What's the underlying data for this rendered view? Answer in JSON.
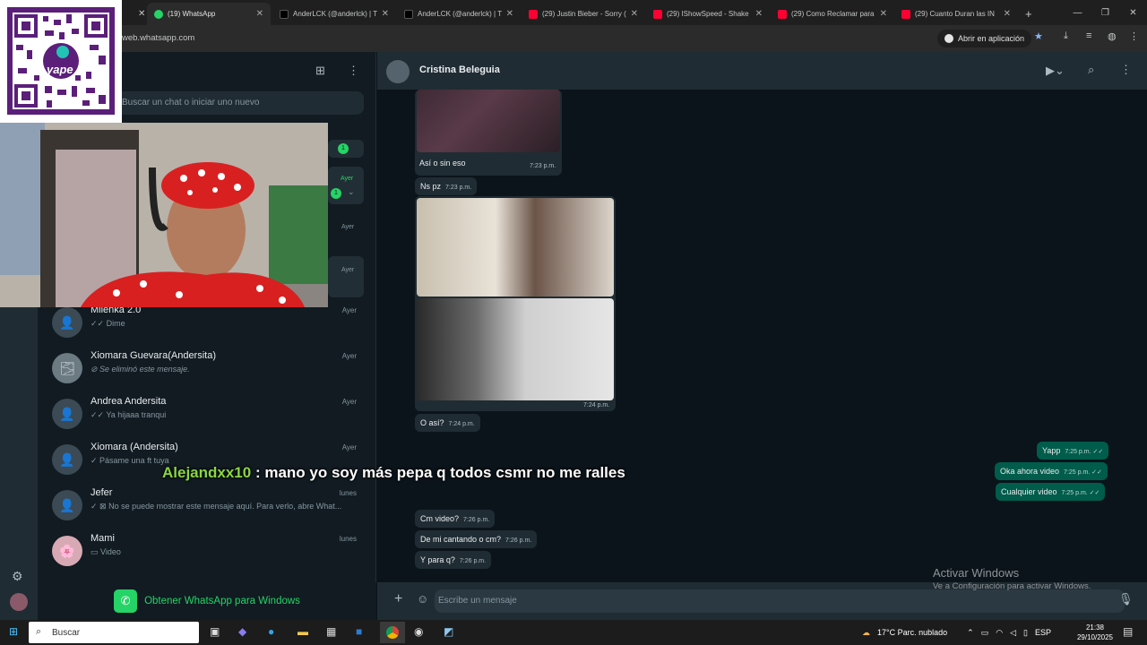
{
  "browser": {
    "tabs": [
      {
        "title": "(19) WhatsApp",
        "color": "#25d366",
        "active": true
      },
      {
        "title": "AnderLCK (@anderlck) | T",
        "color": "#000000"
      },
      {
        "title": "AnderLCK (@anderlck) | T",
        "color": "#000000"
      },
      {
        "title": "(29) Justin Bieber - Sorry (",
        "color": "#ff0033"
      },
      {
        "title": "(29) IShowSpeed - Shake",
        "color": "#ff0033"
      },
      {
        "title": "(29) Como Reclamar para",
        "color": "#ff0033"
      },
      {
        "title": "(29) Cuanto Duran las IN",
        "color": "#ff0033"
      }
    ],
    "new_tab": "+",
    "url": "web.whatsapp.com",
    "open_in_app": "Abrir en aplicación"
  },
  "left": {
    "search_placeholder": "Buscar un chat o iniciar uno nuevo",
    "chips": [
      {
        "badge": "1",
        "time": ""
      },
      {
        "badge": "1",
        "time": "Ayer"
      },
      {
        "time": "Ayer"
      },
      {
        "time": "Ayer"
      }
    ],
    "chats": [
      {
        "name": "Milenka 2.0",
        "preview": "✓✓ Dime",
        "time": "Ayer",
        "initial": "👤"
      },
      {
        "name": "Xiomara Guevara(Andersita)",
        "preview": "⊘ Se eliminó este mensaje.",
        "time": "Ayer",
        "initial": "🌫"
      },
      {
        "name": "Andrea Andersita",
        "preview": "✓✓ Ya hijaaa tranqui",
        "time": "Ayer",
        "initial": "👤"
      },
      {
        "name": "Xiomara (Andersita)",
        "preview": "✓ Pásame una ft tuya",
        "time": "Ayer",
        "initial": "👤"
      },
      {
        "name": "Jefer",
        "preview": "✓ ⊠ No se puede mostrar este mensaje aquí. Para verlo, abre What...",
        "time": "lunes",
        "initial": "👤"
      },
      {
        "name": "Mami",
        "preview": "▭ Video",
        "time": "lunes",
        "initial": "🌸"
      }
    ],
    "get_windows": "Obtener WhatsApp para Windows"
  },
  "chat": {
    "contact": "Cristina Beleguia",
    "incoming": [
      {
        "text": "Así o sin eso",
        "time": "7:23 p.m."
      },
      {
        "text": "Ns pz",
        "time": "7:23 p.m."
      },
      {
        "text": "",
        "time": "7:24 p.m."
      },
      {
        "text": "O así?",
        "time": "7:24 p.m."
      },
      {
        "text": "Cm video?",
        "time": "7:26 p.m."
      },
      {
        "text": "De mi cantando o cm?",
        "time": "7:26 p.m."
      },
      {
        "text": "Y para q?",
        "time": "7:26 p.m."
      }
    ],
    "outgoing": [
      {
        "text": "Yapp",
        "time": "7:25 p.m. ✓✓"
      },
      {
        "text": "Oka ahora video",
        "time": "7:25 p.m. ✓✓"
      },
      {
        "text": "Cualquier video",
        "time": "7:25 p.m. ✓✓"
      }
    ],
    "input_placeholder": "Escribe un mensaje"
  },
  "overlay": {
    "user": "Alejandxx10",
    "text": " : mano yo soy más pepa q todos csmr no me ralles",
    "qr_label": "yape"
  },
  "activate": {
    "title": "Activar Windows",
    "subtitle": "Ve a Configuración para activar Windows."
  },
  "taskbar": {
    "search": "Buscar",
    "weather": "17°C  Parc. nublado",
    "lang": "ESP",
    "time": "21:38",
    "date": "29/10/2025"
  }
}
